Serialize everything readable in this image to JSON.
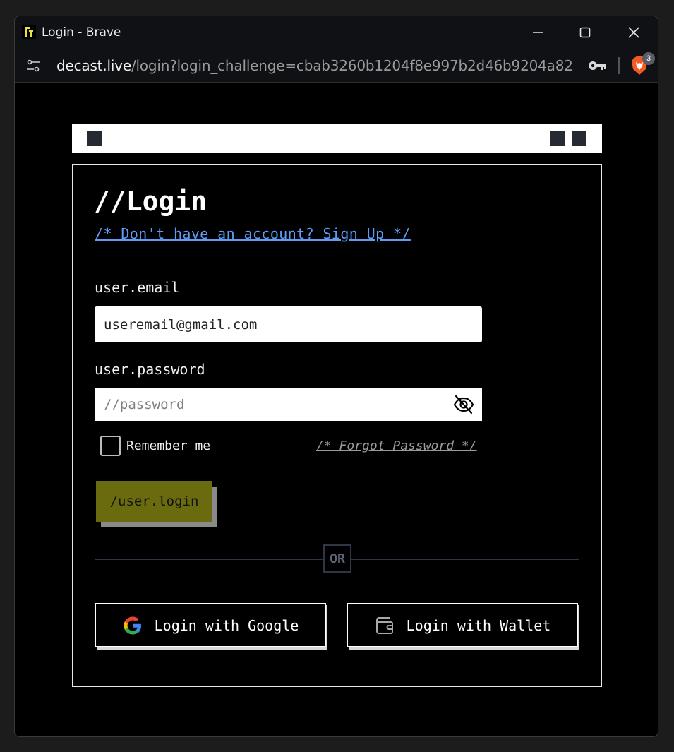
{
  "window": {
    "title": "Login - Brave",
    "icons": {
      "app": "decast-app-icon",
      "minimize": "minimize-icon",
      "maximize": "maximize-icon",
      "close": "close-icon"
    }
  },
  "addressbar": {
    "host": "decast.live",
    "path": "/login?login_challenge=cbab3260b1204f8e997b2d46b9204a82",
    "brave_badge_count": "3",
    "icons": {
      "site_controls": "site-controls-icon",
      "password_key": "key-icon",
      "brave_shields": "brave-lion-icon"
    }
  },
  "page": {
    "title": "//Login",
    "signup_link": "/* Don't have an account? Sign Up */",
    "email": {
      "label": "user.email",
      "value": "useremail@gmail.com"
    },
    "password": {
      "label": "user.password",
      "placeholder": "//password",
      "toggle_icon": "eye-slash-icon"
    },
    "remember_label": "Remember me",
    "remember_checked": false,
    "forgot_link": "/* Forgot Password */",
    "login_button": "/user.login",
    "divider_text": "OR",
    "social": {
      "google_label": "Login with Google",
      "google_icon": "google-icon",
      "wallet_label": "Login with Wallet",
      "wallet_icon": "wallet-icon"
    }
  },
  "colors": {
    "link_blue": "#5e9cf5",
    "login_button_bg": "#6a6b0f",
    "page_bg": "#000000",
    "divider": "#2f3645"
  }
}
